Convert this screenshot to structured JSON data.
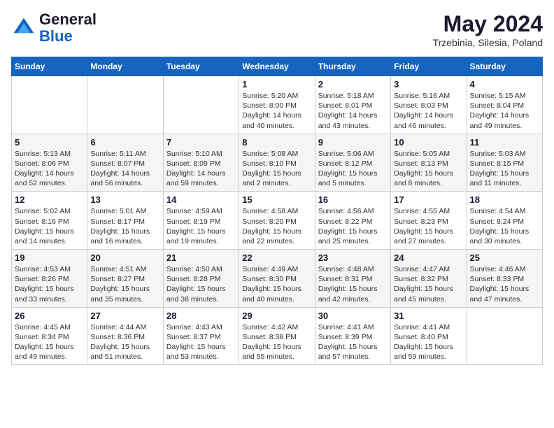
{
  "header": {
    "logo_line1": "General",
    "logo_line2": "Blue",
    "month_year": "May 2024",
    "location": "Trzebinia, Silesia, Poland"
  },
  "weekdays": [
    "Sunday",
    "Monday",
    "Tuesday",
    "Wednesday",
    "Thursday",
    "Friday",
    "Saturday"
  ],
  "weeks": [
    [
      {
        "day": "",
        "info": ""
      },
      {
        "day": "",
        "info": ""
      },
      {
        "day": "",
        "info": ""
      },
      {
        "day": "1",
        "info": "Sunrise: 5:20 AM\nSunset: 8:00 PM\nDaylight: 14 hours\nand 40 minutes."
      },
      {
        "day": "2",
        "info": "Sunrise: 5:18 AM\nSunset: 8:01 PM\nDaylight: 14 hours\nand 43 minutes."
      },
      {
        "day": "3",
        "info": "Sunrise: 5:16 AM\nSunset: 8:03 PM\nDaylight: 14 hours\nand 46 minutes."
      },
      {
        "day": "4",
        "info": "Sunrise: 5:15 AM\nSunset: 8:04 PM\nDaylight: 14 hours\nand 49 minutes."
      }
    ],
    [
      {
        "day": "5",
        "info": "Sunrise: 5:13 AM\nSunset: 8:06 PM\nDaylight: 14 hours\nand 52 minutes."
      },
      {
        "day": "6",
        "info": "Sunrise: 5:11 AM\nSunset: 8:07 PM\nDaylight: 14 hours\nand 56 minutes."
      },
      {
        "day": "7",
        "info": "Sunrise: 5:10 AM\nSunset: 8:09 PM\nDaylight: 14 hours\nand 59 minutes."
      },
      {
        "day": "8",
        "info": "Sunrise: 5:08 AM\nSunset: 8:10 PM\nDaylight: 15 hours\nand 2 minutes."
      },
      {
        "day": "9",
        "info": "Sunrise: 5:06 AM\nSunset: 8:12 PM\nDaylight: 15 hours\nand 5 minutes."
      },
      {
        "day": "10",
        "info": "Sunrise: 5:05 AM\nSunset: 8:13 PM\nDaylight: 15 hours\nand 8 minutes."
      },
      {
        "day": "11",
        "info": "Sunrise: 5:03 AM\nSunset: 8:15 PM\nDaylight: 15 hours\nand 11 minutes."
      }
    ],
    [
      {
        "day": "12",
        "info": "Sunrise: 5:02 AM\nSunset: 8:16 PM\nDaylight: 15 hours\nand 14 minutes."
      },
      {
        "day": "13",
        "info": "Sunrise: 5:01 AM\nSunset: 8:17 PM\nDaylight: 15 hours\nand 16 minutes."
      },
      {
        "day": "14",
        "info": "Sunrise: 4:59 AM\nSunset: 8:19 PM\nDaylight: 15 hours\nand 19 minutes."
      },
      {
        "day": "15",
        "info": "Sunrise: 4:58 AM\nSunset: 8:20 PM\nDaylight: 15 hours\nand 22 minutes."
      },
      {
        "day": "16",
        "info": "Sunrise: 4:56 AM\nSunset: 8:22 PM\nDaylight: 15 hours\nand 25 minutes."
      },
      {
        "day": "17",
        "info": "Sunrise: 4:55 AM\nSunset: 8:23 PM\nDaylight: 15 hours\nand 27 minutes."
      },
      {
        "day": "18",
        "info": "Sunrise: 4:54 AM\nSunset: 8:24 PM\nDaylight: 15 hours\nand 30 minutes."
      }
    ],
    [
      {
        "day": "19",
        "info": "Sunrise: 4:53 AM\nSunset: 8:26 PM\nDaylight: 15 hours\nand 33 minutes."
      },
      {
        "day": "20",
        "info": "Sunrise: 4:51 AM\nSunset: 8:27 PM\nDaylight: 15 hours\nand 35 minutes."
      },
      {
        "day": "21",
        "info": "Sunrise: 4:50 AM\nSunset: 8:28 PM\nDaylight: 15 hours\nand 38 minutes."
      },
      {
        "day": "22",
        "info": "Sunrise: 4:49 AM\nSunset: 8:30 PM\nDaylight: 15 hours\nand 40 minutes."
      },
      {
        "day": "23",
        "info": "Sunrise: 4:48 AM\nSunset: 8:31 PM\nDaylight: 15 hours\nand 42 minutes."
      },
      {
        "day": "24",
        "info": "Sunrise: 4:47 AM\nSunset: 8:32 PM\nDaylight: 15 hours\nand 45 minutes."
      },
      {
        "day": "25",
        "info": "Sunrise: 4:46 AM\nSunset: 8:33 PM\nDaylight: 15 hours\nand 47 minutes."
      }
    ],
    [
      {
        "day": "26",
        "info": "Sunrise: 4:45 AM\nSunset: 8:34 PM\nDaylight: 15 hours\nand 49 minutes."
      },
      {
        "day": "27",
        "info": "Sunrise: 4:44 AM\nSunset: 8:36 PM\nDaylight: 15 hours\nand 51 minutes."
      },
      {
        "day": "28",
        "info": "Sunrise: 4:43 AM\nSunset: 8:37 PM\nDaylight: 15 hours\nand 53 minutes."
      },
      {
        "day": "29",
        "info": "Sunrise: 4:42 AM\nSunset: 8:38 PM\nDaylight: 15 hours\nand 55 minutes."
      },
      {
        "day": "30",
        "info": "Sunrise: 4:41 AM\nSunset: 8:39 PM\nDaylight: 15 hours\nand 57 minutes."
      },
      {
        "day": "31",
        "info": "Sunrise: 4:41 AM\nSunset: 8:40 PM\nDaylight: 15 hours\nand 59 minutes."
      },
      {
        "day": "",
        "info": ""
      }
    ]
  ]
}
